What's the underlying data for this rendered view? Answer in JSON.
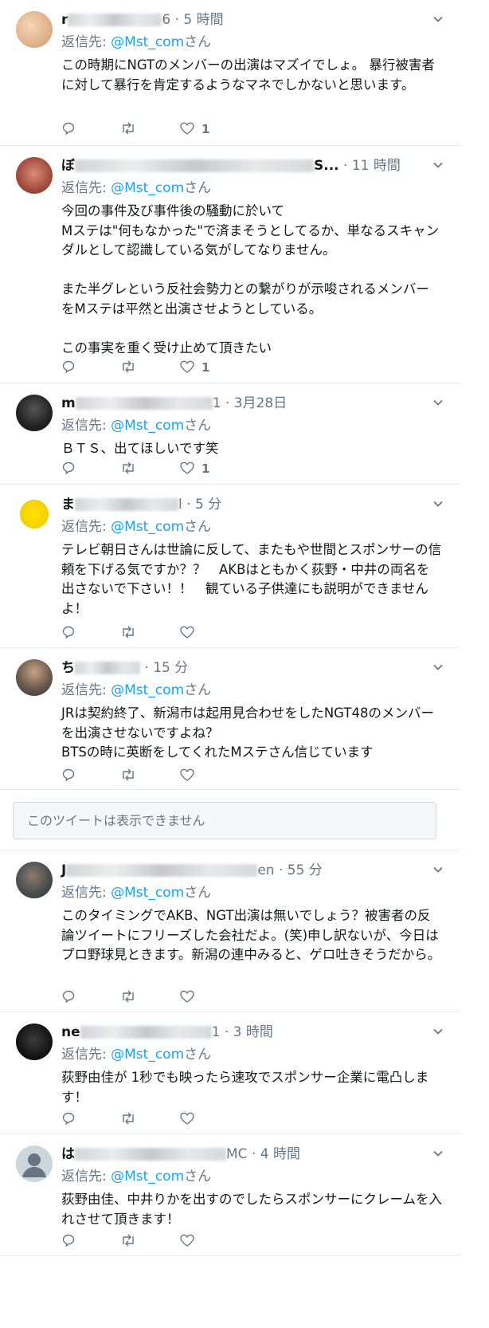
{
  "reply_prefix": "返信先:",
  "reply_suffix": "さん",
  "reply_handle": "@Mst_com",
  "unavailable": "このツイートは表示できません",
  "tweets": [
    {
      "name": "r",
      "name_tail": "6",
      "time": "· 5 時間",
      "text": "この時期にNGTのメンバーの出演はマズイでしょ。 暴行被害者に対して暴行を肯定するようなマネでしかないと思います。",
      "likes": "1"
    },
    {
      "name": "ぼ",
      "name_tail": "S...",
      "time": "· 11 時間",
      "text": "今回の事件及び事件後の騒動に於いて\nMステは\"何もなかった\"で済まそうとしてるか、単なるスキャンダルとして認識している気がしてなりません。\n\nまた半グレという反社会勢力との繋がりが示唆されるメンバーをMステは平然と出演させようとしている。\n\nこの事実を重く受け止めて頂きたい",
      "likes": "1"
    },
    {
      "name": "m",
      "name_tail": "1",
      "time": "· 3月28日",
      "text": "ＢＴＳ、出てほしいです笑",
      "likes": "1"
    },
    {
      "name": "ま",
      "name_tail": "l",
      "time": "· 5 分",
      "text": "テレビ朝日さんは世論に反して、またもや世間とスポンサーの信頼を下げる気ですか？？　AKBはともかく荻野・中井の両名を出さないで下さい！！　観ている子供達にも説明ができませんよ！",
      "likes": ""
    },
    {
      "name": "ち",
      "name_tail": "",
      "time": "· 15 分",
      "text": "JRは契約終了、新潟市は起用見合わせをしたNGT48のメンバーを出演させないですよね？\nBTSの時に英断をしてくれたMステさん信じています",
      "likes": ""
    },
    {
      "name": "J",
      "name_tail": "en",
      "time": "· 55 分",
      "text": "このタイミングでAKB、NGT出演は無いでしょう？被害者の反論ツイートにフリーズした会社だよ。(笑)申し訳ないが、今日はプロ野球見ときます。新潟の連中みると、ゲロ吐きそうだから。",
      "likes": ""
    },
    {
      "name": "ne",
      "name_tail": "1",
      "time": "· 3 時間",
      "text": "荻野由佳が 1秒でも映ったら速攻でスポンサー企業に電凸します！",
      "likes": ""
    },
    {
      "name": "は",
      "name_tail": "MC",
      "time": "· 4 時間",
      "text": "荻野由佳、中井りかを出すのでしたらスポンサーにクレームを入れさせて頂きます！",
      "likes": ""
    }
  ]
}
